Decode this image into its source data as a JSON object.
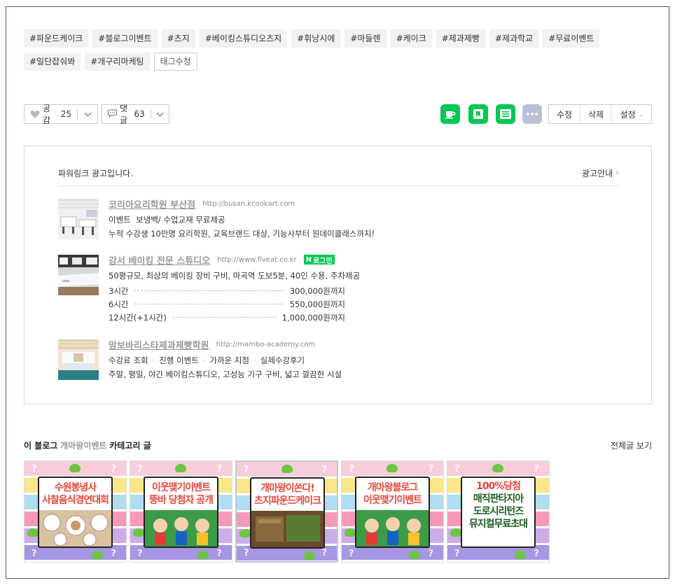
{
  "tags": [
    "#파운드케이크",
    "#블로그이벤트",
    "#츠지",
    "#베이킹스튜디오츠지",
    "#휘낭시에",
    "#마들렌",
    "#케이크",
    "#제과제빵",
    "#제과학교",
    "#무료이벤트",
    "#일단잡숴봐",
    "#개구리마케팅"
  ],
  "tag_edit": "태그수정",
  "like": {
    "label": "공감",
    "count": "25"
  },
  "comment": {
    "label": "댓글",
    "count": "63"
  },
  "owner_buttons": {
    "edit": "수정",
    "delete": "삭제",
    "settings": "설정"
  },
  "colors": {
    "naver_green": "#06c755",
    "more_gray": "#b8c2d6"
  },
  "ad": {
    "header": "파워링크 광고입니다.",
    "guide": "광고안내",
    "items": [
      {
        "title": "코리아요리학원 부산점",
        "url": "http://busan.kcookart.com",
        "line1_bold": "이벤트",
        "line1": "보냉백/ 수업교재 무료제공",
        "line2": "누적 수강생 10만명 요리학원, 교육브랜드 대상, 기능사부터 원데이클래스까지!"
      },
      {
        "title": "강서 베이킹 전문 스튜디오",
        "url": "http://www.fiveat.co.kr",
        "badge": "로그인",
        "line1": "50평규모, 최상의 베이킹 장비 구비, 마곡역 도보5분, 40인 수용, 주차제공",
        "prices": [
          {
            "label": "3시간",
            "price": "300,000원까지"
          },
          {
            "label": "6시간",
            "price": "550,000원까지"
          },
          {
            "label": "12시간(+1시간)",
            "price": "1,000,000원까지"
          }
        ]
      },
      {
        "title": "맘보바리스타제과제빵학원",
        "url": "http://mambo-academy.com",
        "links": [
          "수강료 조회",
          "진행 이벤트",
          "가까운 지점",
          "실제수강후기"
        ],
        "line2": "주말, 평일, 야간 베이킹스튜디오, 고성능 기구 구비, 넓고 깔끔한 시설"
      }
    ]
  },
  "category": {
    "prefix": "이 블로그",
    "name": "개마왕이벤트",
    "suffix": "카테고리 글",
    "view_all": "전체글 보기",
    "posts": [
      {
        "title1": "수원봉녕사",
        "title2": "사찰음식경연대회",
        "color": "#e8463c"
      },
      {
        "title1": "이웃맺기이벤트",
        "title2": "뚱바 당첨자 공개",
        "color": "#e8463c"
      },
      {
        "title1": "개마왕이쏜다!",
        "title2": "츠지파운드케이크",
        "color": "#e8463c"
      },
      {
        "title1": "개마왕블로그",
        "title2": "이웃맺기이벤트",
        "color": "#e8463c"
      },
      {
        "title1": "100%당첨",
        "title2": "매직판타지아",
        "title3": "도로시리턴즈",
        "title4": "뮤지컬무료초대",
        "color": "#e8463c"
      }
    ]
  }
}
